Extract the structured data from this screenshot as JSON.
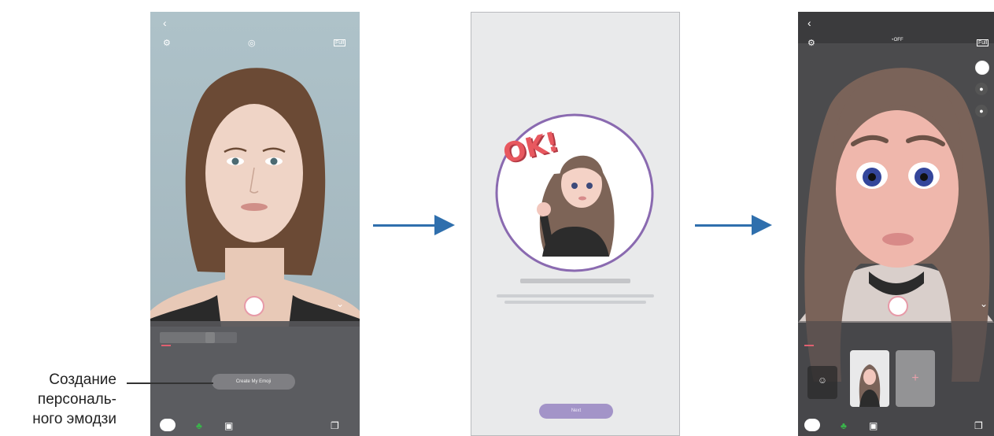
{
  "callout": {
    "line1": "Создание",
    "line2": "персональ-",
    "line3": "ного эмодзи"
  },
  "screen1": {
    "back_icon": "‹",
    "settings_icon": "⚙",
    "mode_icon": "◎",
    "full_label": "Full",
    "create_button": "Create My Emoji"
  },
  "screen2": {
    "sticker_text": "OK!",
    "next_button": "Next"
  },
  "screen3": {
    "back_icon": "‹",
    "settings_icon": "⚙",
    "timer_label": "OFF",
    "full_label": "Full",
    "add_symbol": "+"
  },
  "colors": {
    "arrow": "#2f6fad",
    "accent_pink": "#e06070",
    "button_purple": "#a394c8",
    "circle_border": "#8a6ab0"
  }
}
